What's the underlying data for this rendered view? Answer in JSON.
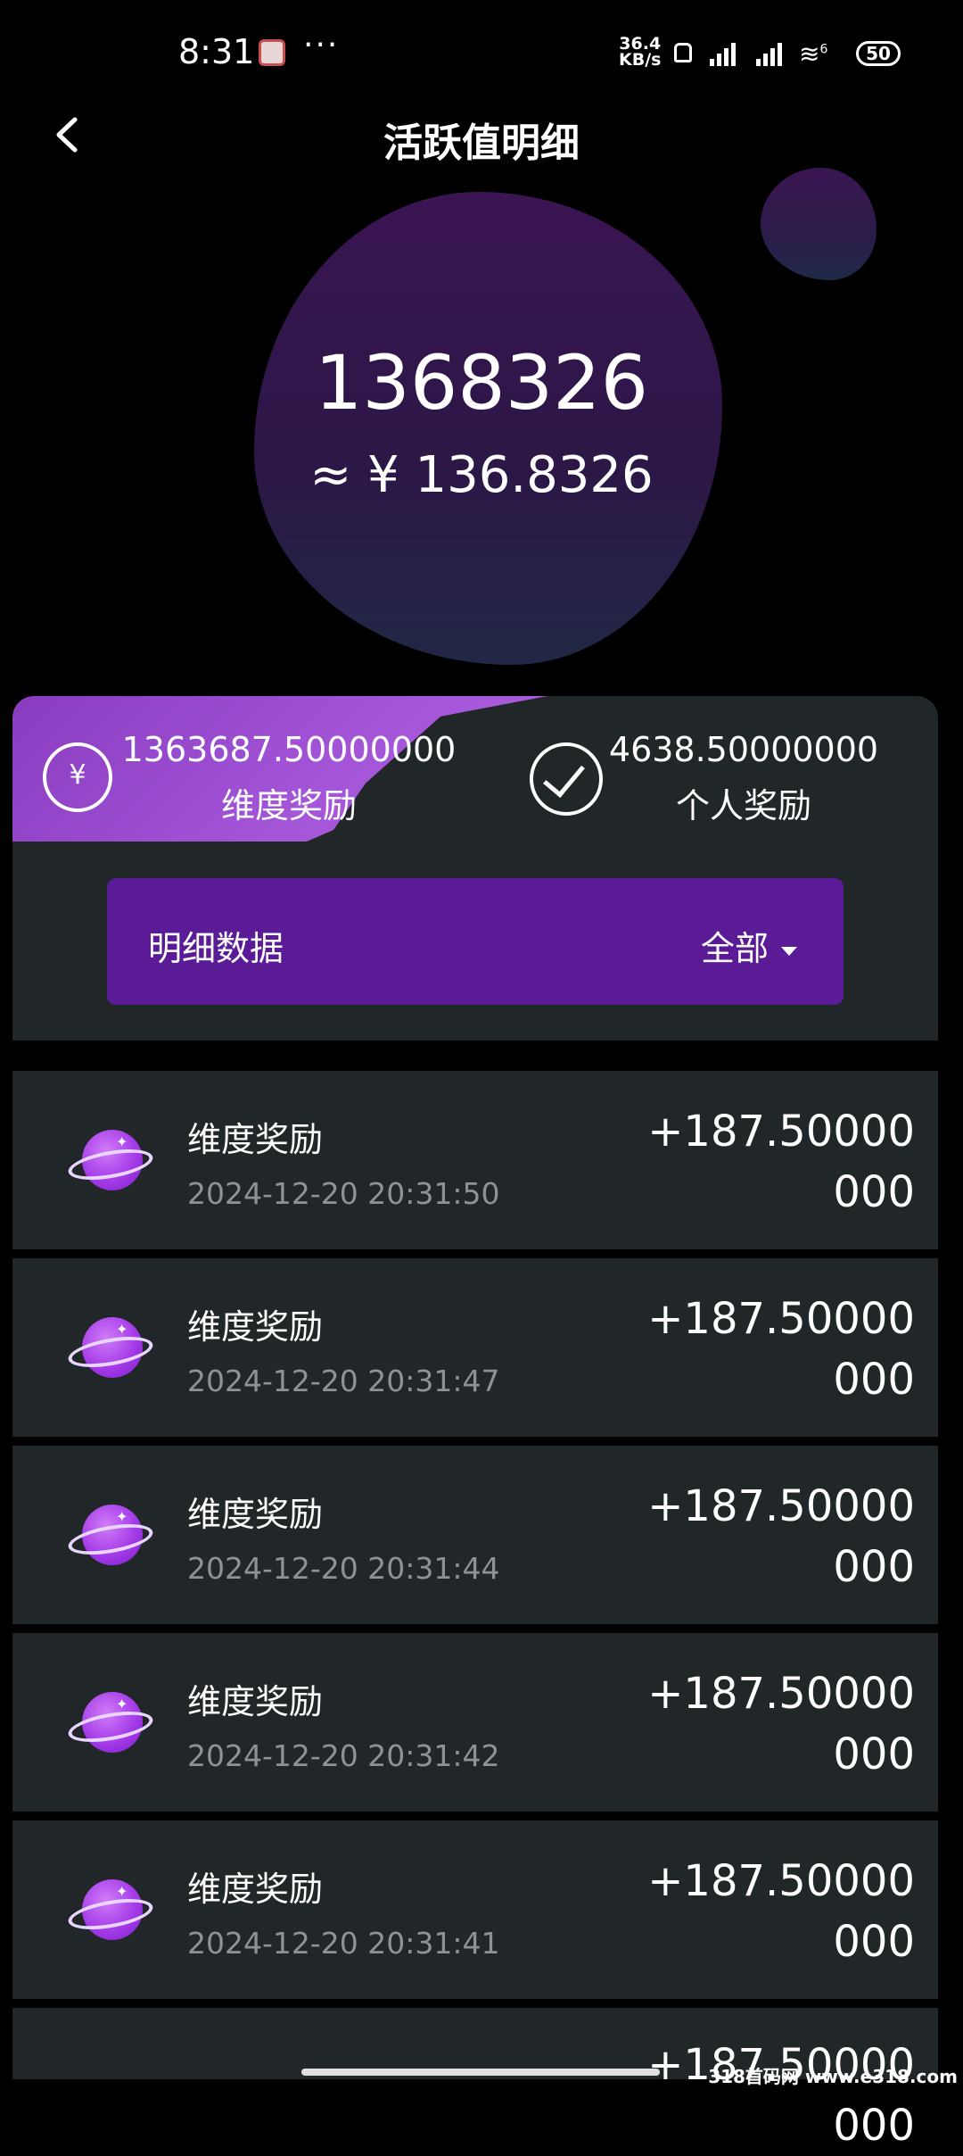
{
  "status_bar": {
    "time": "8:31",
    "more": "···",
    "net_speed_value": "36.4",
    "net_speed_unit": "KB/s",
    "battery": "50",
    "wifi_badge": "6"
  },
  "header": {
    "title": "活跃值明细"
  },
  "summary": {
    "total": "1368326",
    "approx_value": "≈ ¥ 136.8326"
  },
  "tabs": [
    {
      "value": "1363687.50000000",
      "label": "维度奖励",
      "active": true
    },
    {
      "value": "4638.50000000",
      "label": "个人奖励",
      "active": false
    }
  ],
  "filter": {
    "label": "明细数据",
    "selected": "全部"
  },
  "records": [
    {
      "title": "维度奖励",
      "time": "2024-12-20 20:31:50",
      "amount": "+187.50000000"
    },
    {
      "title": "维度奖励",
      "time": "2024-12-20 20:31:47",
      "amount": "+187.50000000"
    },
    {
      "title": "维度奖励",
      "time": "2024-12-20 20:31:44",
      "amount": "+187.50000000"
    },
    {
      "title": "维度奖励",
      "time": "2024-12-20 20:31:42",
      "amount": "+187.50000000"
    },
    {
      "title": "维度奖励",
      "time": "2024-12-20 20:31:41",
      "amount": "+187.50000000"
    }
  ],
  "partial_record_amount": "+187.50000000",
  "watermark": "318首码网 www.e318.com",
  "colors": {
    "background": "#000000",
    "card": "#212629",
    "accent_purple": "#5b1a96",
    "active_tab": "#a455d8"
  }
}
